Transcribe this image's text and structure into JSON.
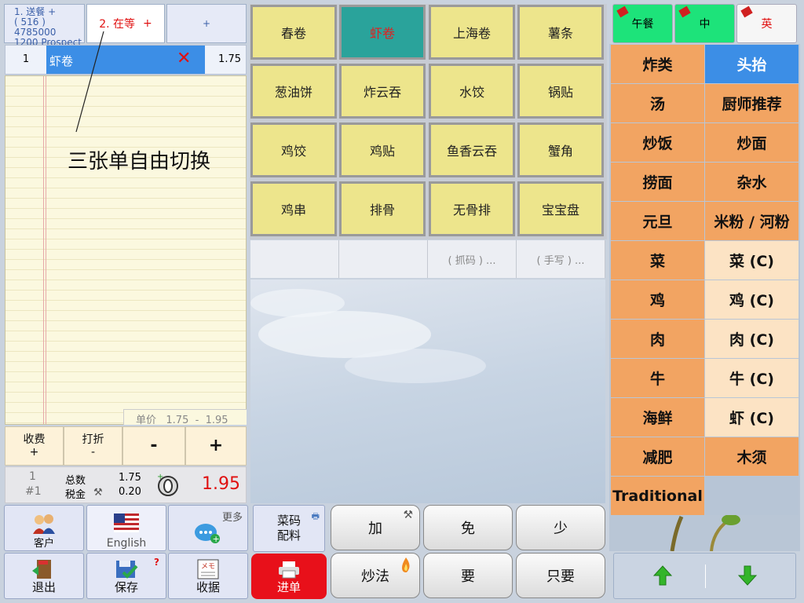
{
  "tickets": [
    {
      "line1": "1. 送餐",
      "plus": "+",
      "line2": "( 516 ) 4785000",
      "line3": "1200 Prospect"
    },
    {
      "label": "2. 在等",
      "plus": "+"
    },
    {
      "label": "+"
    }
  ],
  "order": {
    "qty": "1",
    "name": "虾卷",
    "price": "1.75"
  },
  "annotation": "三张单自由切换",
  "unit_price": "单价   1.75  -  1.95",
  "controls": {
    "charge": "收费",
    "charge_sub": "+",
    "discount": "打折",
    "discount_sub": "-",
    "minus": "-",
    "plus": "+"
  },
  "totals": {
    "count": "1",
    "order_no": "#1",
    "total_label": "总数",
    "tax_label": "税金",
    "total_value": "1.75",
    "tax_value": "0.20",
    "grand_total": "1.95"
  },
  "left_tools": {
    "customer": "客户",
    "english": "English",
    "more": "更多",
    "exit": "退出",
    "save": "保存",
    "save_badge": "?",
    "receipt": "收据",
    "memo": "メモ"
  },
  "menu_items": [
    "春卷",
    "虾卷",
    "上海卷",
    "薯条",
    "葱油饼",
    "炸云吞",
    "水饺",
    "锅贴",
    "鸡饺",
    "鸡贴",
    "鱼香云吞",
    "蟹角",
    "鸡串",
    "排骨",
    "无骨排",
    "宝宝盘"
  ],
  "menu_extra": [
    "",
    "",
    "( 抓码 ) ...",
    "( 手写 ) ..."
  ],
  "mid_tools": {
    "code": "菜码",
    "code2": "配料",
    "submit": "进单",
    "add": "加",
    "free": "免",
    "less": "少",
    "method": "炒法",
    "want": "要",
    "only": "只要"
  },
  "meal_tabs": [
    "午餐",
    "中",
    "英"
  ],
  "categories": [
    [
      "炸类",
      "头抬"
    ],
    [
      "汤",
      "厨师推荐"
    ],
    [
      "炒饭",
      "炒面"
    ],
    [
      "捞面",
      "杂水"
    ],
    [
      "元旦",
      "米粉 / 河粉"
    ],
    [
      "菜",
      "菜 (C)"
    ],
    [
      "鸡",
      "鸡 (C)"
    ],
    [
      "肉",
      "肉 (C)"
    ],
    [
      "牛",
      "牛 (C)"
    ],
    [
      "海鲜",
      "虾 (C)"
    ],
    [
      "减肥",
      "木须"
    ],
    [
      "Traditional",
      ""
    ]
  ],
  "colors": {
    "accent_blue": "#3c8ee6",
    "selected_teal": "#2aa39b",
    "total_red": "#e01010",
    "submit_red": "#e8101a"
  }
}
